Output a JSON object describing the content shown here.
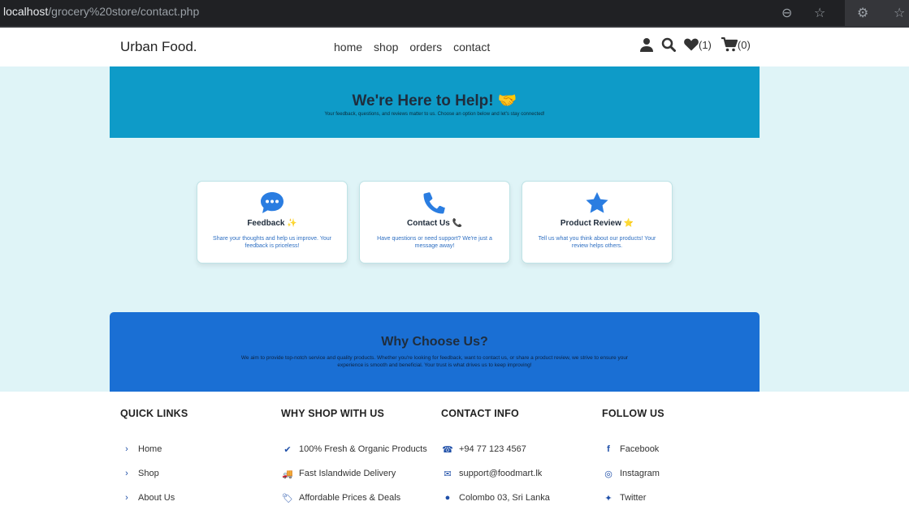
{
  "browser": {
    "url_host": "localhost",
    "url_path": "/grocery%20store/contact.php"
  },
  "navbar": {
    "brand": "Urban Food.",
    "links": [
      "home",
      "shop",
      "orders",
      "contact"
    ],
    "wishlist_count": "(1)",
    "cart_count": "(0)"
  },
  "hero": {
    "title": "We're Here to Help! 🤝",
    "subtitle": "Your feedback, questions, and reviews matter to us. Choose an option below and let's stay connected!"
  },
  "cards": [
    {
      "title": "Feedback ✨",
      "text": "Share your thoughts and help us improve. Your feedback is priceless!",
      "icon": "chat-bubble-icon"
    },
    {
      "title": "Contact Us 📞",
      "text": "Have questions or need support? We're just a message away!",
      "icon": "phone-icon"
    },
    {
      "title": "Product Review ⭐",
      "text": "Tell us what you think about our products! Your review helps others.",
      "icon": "star-icon"
    }
  ],
  "why": {
    "title": "Why Choose Us?",
    "text": "We aim to provide top-notch service and quality products. Whether you're looking for feedback, want to contact us, or share a product review, we strive to ensure your experience is smooth and beneficial. Your trust is what drives us to keep improving!"
  },
  "footer": {
    "quick_links": {
      "title": "QUICK LINKS",
      "items": [
        "Home",
        "Shop",
        "About Us"
      ]
    },
    "why_shop": {
      "title": "WHY SHOP WITH US",
      "items": [
        "100% Fresh & Organic Products",
        "Fast Islandwide Delivery",
        "Affordable Prices & Deals"
      ]
    },
    "contact": {
      "title": "CONTACT INFO",
      "items": [
        "+94 77 123 4567",
        "support@foodmart.lk",
        "Colombo 03, Sri Lanka"
      ]
    },
    "follow": {
      "title": "FOLLOW US",
      "items": [
        "Facebook",
        "Instagram",
        "Twitter"
      ]
    }
  },
  "colors": {
    "hero": "#0e9bc8",
    "why": "#1a6fd4",
    "page_bg": "#dff4f7",
    "icon_blue": "#2a7de1"
  }
}
